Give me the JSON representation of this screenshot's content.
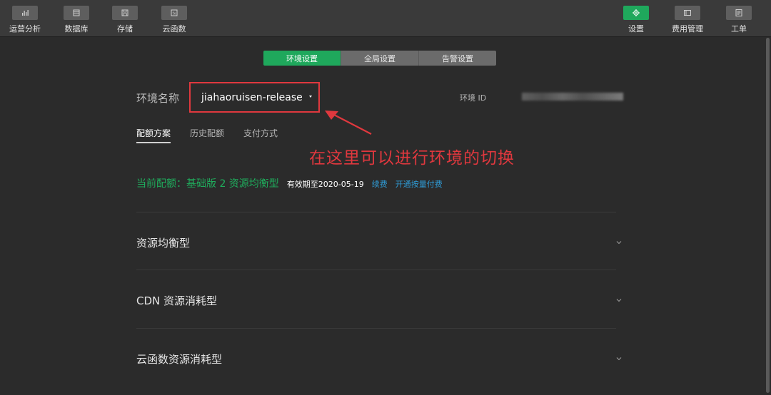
{
  "toolbar": {
    "left": [
      {
        "label": "运营分析",
        "icon": "bar-chart-icon"
      },
      {
        "label": "数据库",
        "icon": "database-icon"
      },
      {
        "label": "存储",
        "icon": "save-icon"
      },
      {
        "label": "云函数",
        "icon": "function-icon"
      }
    ],
    "right": [
      {
        "label": "设置",
        "icon": "gear-icon",
        "active": true
      },
      {
        "label": "费用管理",
        "icon": "billing-icon"
      },
      {
        "label": "工单",
        "icon": "ticket-icon"
      }
    ]
  },
  "tabs": [
    {
      "label": "环境设置",
      "active": true
    },
    {
      "label": "全局设置",
      "active": false
    },
    {
      "label": "告警设置",
      "active": false
    }
  ],
  "env": {
    "label": "环境名称",
    "selected": "jiahaoruisen-release",
    "id_label": "环境 ID"
  },
  "annotation": {
    "text": "在这里可以进行环境的切换",
    "color": "#e0383e"
  },
  "subtabs": [
    {
      "label": "配额方案",
      "active": true
    },
    {
      "label": "历史配额",
      "active": false
    },
    {
      "label": "支付方式",
      "active": false
    }
  ],
  "plan": {
    "current": "当前配额：基础版 2 资源均衡型",
    "expire": "有效期至2020-05-19",
    "renew": "续费",
    "pay_as_you_go": "开通按量付费"
  },
  "sections": [
    {
      "title": "资源均衡型"
    },
    {
      "title": "CDN 资源消耗型"
    },
    {
      "title": "云函数资源消耗型"
    }
  ],
  "colors": {
    "accent": "#1fa85c",
    "link": "#2f9dd8",
    "highlight": "#e0383e",
    "background": "#2b2b2b"
  }
}
